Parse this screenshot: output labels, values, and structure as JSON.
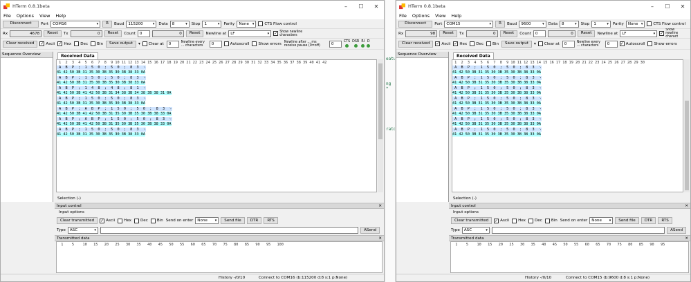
{
  "codestrip": {
    "line1": "eatu",
    "line2": "ng *",
    "line3": "rator"
  },
  "left": {
    "title": "HTerm 0.8.1beta",
    "menu": [
      "File",
      "Options",
      "View",
      "Help"
    ],
    "disconnect": "Disconnect",
    "port_label": "Port",
    "port": "COM16",
    "r": "R",
    "baud_label": "Baud",
    "baud": "115200",
    "data_label": "Data",
    "data": "8",
    "stop_label": "Stop",
    "stop": "1",
    "parity_label": "Parity",
    "parity": "None",
    "cts": "CTS Flow control",
    "rx_label": "Rx",
    "rx": "4678",
    "reset": "Reset",
    "tx_label": "Tx",
    "tx": "0",
    "count_label": "Count",
    "count": "0",
    "count_val": "0",
    "newline_at": "Newline at",
    "newline_val": "LF",
    "show_newline": "Show newline characters",
    "clear_received": "Clear received",
    "ascii": "Ascii",
    "hex": "Hex",
    "dec": "Dec",
    "bin": "Bin",
    "save_output": "Save output",
    "clear_at": "Clear at",
    "clear_at_val": "0",
    "newline_every": "Newline every ... characters",
    "newline_every_val": "0",
    "autoscroll": "Autoscroll",
    "show_errors": "Show errors",
    "newline_pause": "Newline after ... ms receive pause (0=off)",
    "newline_pause_val": "0",
    "leds": [
      "CTS",
      "DSR",
      "RI",
      "D"
    ],
    "seq_overview": "Sequence Overview",
    "received_tab": "Received Data",
    "ruler": " 1  2  3  4  5  6  7  8  9 10 11 12 13 14 15 16 17 18 19 20 21 22 23 24 25 26 27 28 29 30 31 32 33 34 35 36 37 38 39 40 41 42",
    "rows": [
      {
        "a": " A  B  P  ;  1  5  0  ;  5  0  ;  8  3  ␊",
        "h": "41 42 50 3B 31 35 30 3B 35 30 3B 38 33 0A"
      },
      {
        "a": " A  B  P  ;  1  5  0  ;  5  0  ;  8  3  ␊",
        "h": "41 42 50 3B 31 35 30 3B 35 30 3B 38 33 0A"
      },
      {
        "a": " A  B  P  ;  1  4  8  ;  4  8  ;  8  1  ␊",
        "h": "41 42 50 3B 41 42 50 3B 31 34 38 3B 34 38 3B 38 31 0A"
      },
      {
        "a": " A  B  P  ;  1  5  0  ;  5  0  ;  8  3  ␊",
        "h": "41 42 50 3B 31 35 30 3B 35 30 3B 38 33 0A"
      },
      {
        "a": " A  B  P  ;  A  B  P  ;  1  5  0  ;  5  0  ;  8  3  ␊",
        "h": "41 42 50 3B 41 42 50 3B 31 35 30 3B 35 30 3B 38 33 0A"
      },
      {
        "a": " A  B  P  ;  A  B  P  ;  1  5  0  ;  5  0  ;  8  3  ␊",
        "h": "41 42 50 3B 41 42 50 3B 31 35 30 3B 35 30 3B 38 33 0A"
      },
      {
        "a": " A  B  P  ;  1  5  0  ;  5  0  ;  8  3  ␊",
        "h": "41 42 50 3B 31 35 30 3B 35 30 3B 38 33 0A"
      }
    ],
    "selection": "Selection (-)",
    "input_control": "Input control",
    "input_options": "Input options",
    "clear_transmitted": "Clear transmitted",
    "send_on_enter": "Send on enter",
    "send_on_enter_val": "None",
    "send_file": "Send file",
    "dtr": "DTR",
    "rts": "RTS",
    "type_label": "Type",
    "type_val": "ASC",
    "asend": "ASend",
    "transmitted": "Transmitted data",
    "tx_ruler": "  1    5    10   15   20   25   30   35   40   45   50   55   60   65   70   75   80   85   90   95   100",
    "history": "History -/0/10",
    "connect_status": "Connect to COM16 (b:115200 d:8 s:1 p:None)"
  },
  "right": {
    "title": "HTerm 0.8.1beta",
    "menu": [
      "File",
      "Options",
      "View",
      "Help"
    ],
    "disconnect": "Disconnect",
    "port_label": "Port",
    "port": "COM15",
    "r": "R",
    "baud_label": "Baud",
    "baud": "9600",
    "data_label": "Data",
    "data": "8",
    "stop_label": "Stop",
    "stop": "1",
    "parity_label": "Parity",
    "parity": "None",
    "cts": "CTS Flow control",
    "rx_label": "Rx",
    "rx": "98",
    "reset": "Reset",
    "tx_label": "Tx",
    "tx": "0",
    "count_label": "Count",
    "count": "0",
    "count_val": "0",
    "newline_at": "Newline at",
    "newline_val": "LF",
    "show_newline": "Show newline characters",
    "clear_received": "Clear received",
    "ascii": "Ascii",
    "hex": "Hex",
    "dec": "Dec",
    "bin": "Bin",
    "save_output": "Save output",
    "clear_at": "Clear at",
    "clear_at_val": "0",
    "newline_every": "Newline every ... characters",
    "newline_every_val": "0",
    "autoscroll": "Autoscroll",
    "show_errors": "Show errors",
    "seq_overview": "Sequence Overview",
    "received_tab": "Received Data",
    "ruler": " 1  2  3  4  5  6  7  8  9 10 11 12 13 14 15 16 17 18 19 20 21 22 23 24 25 26 27 28 29 30",
    "rows": [
      {
        "a": " A  B  P  ;  1  5  0  ;  5  0  ;  8  3  ␊",
        "h": "41 42 50 3B 31 35 30 3B 35 30 3B 38 33 0A"
      },
      {
        "a": " A  B  P  ;  1  5  0  ;  5  0  ;  8  3  ␊",
        "h": "41 42 50 3B 31 35 30 3B 35 30 3B 38 33 0A"
      },
      {
        "a": " A  B  P  ;  1  5  0  ;  5  0  ;  8  3  ␊",
        "h": "41 42 50 3B 31 35 30 3B 35 30 3B 38 33 0A"
      },
      {
        "a": " A  B  P  ;  1  5  0  ;  5  0  ;  8  3  ␊",
        "h": "41 42 50 3B 31 35 30 3B 35 30 3B 38 33 0A"
      },
      {
        "a": " A  B  P  ;  1  5  0  ;  5  0  ;  8  3  ␊",
        "h": "41 42 50 3B 31 35 30 3B 35 30 3B 38 33 0A"
      },
      {
        "a": " A  B  P  ;  1  5  0  ;  5  0  ;  8  3  ␊",
        "h": "41 42 50 3B 31 35 30 3B 35 30 3B 38 33 0A"
      },
      {
        "a": " A  B  P  ;  1  5  0  ;  5  0  ;  8  3  ␊",
        "h": "41 42 50 3B 31 35 30 3B 35 30 3B 38 33 0A"
      }
    ],
    "selection": "Selection (-)",
    "input_control": "Input control",
    "input_options": "Input options",
    "clear_transmitted": "Clear transmitted",
    "send_on_enter": "Send on enter",
    "send_on_enter_val": "None",
    "send_file": "Send file",
    "dtr": "DTR",
    "rts": "RTS",
    "type_label": "Type",
    "type_val": "ASC",
    "asend": "ASend",
    "transmitted": "Transmitted data",
    "tx_ruler": "  1    5    10   15   20   25   30   35   40   45   50   55   60   65   70   75   80   85   90   95",
    "history": "History -/0/10",
    "connect_status": "Connect to COM15 (b:9600 d:8 s:1 p:None)"
  }
}
